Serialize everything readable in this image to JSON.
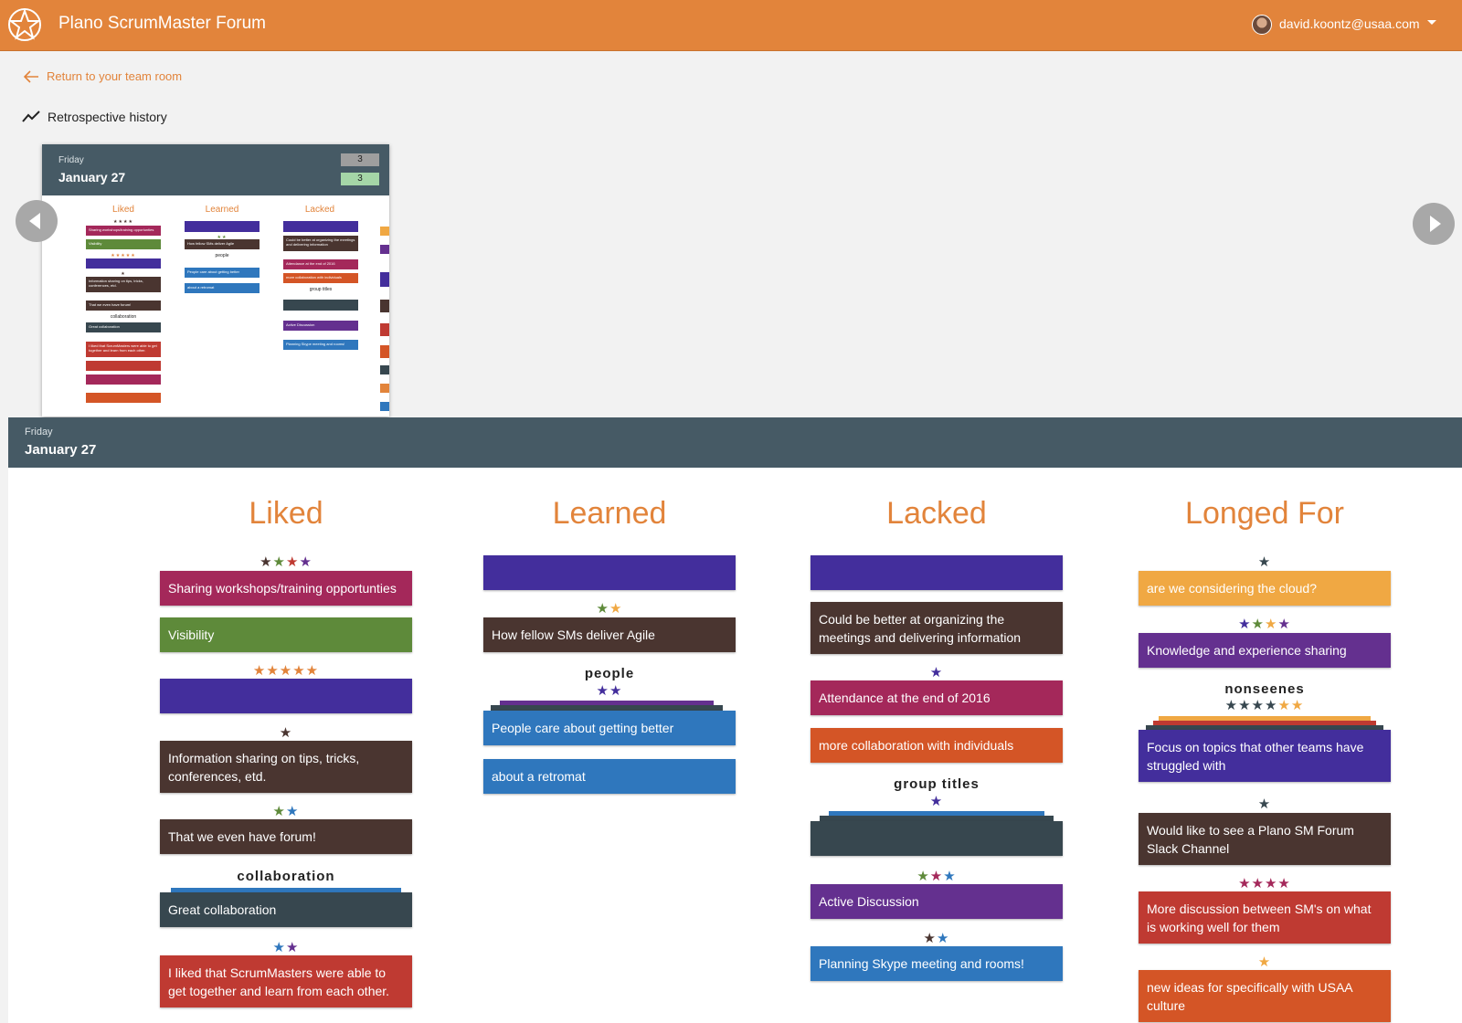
{
  "app": {
    "title": "Plano ScrumMaster Forum",
    "user_email": "david.koontz@usaa.com"
  },
  "nav": {
    "back_label": "Return to your team room",
    "history_label": "Retrospective history"
  },
  "thumbnail": {
    "day": "Friday",
    "date": "January 27",
    "badge_count_1": "3",
    "badge_count_2": "3",
    "columns": [
      "Liked",
      "Learned",
      "Lacked"
    ],
    "group_labels": [
      "people",
      "collaboration",
      "group titles"
    ]
  },
  "board": {
    "day": "Friday",
    "date": "January 27",
    "columns": {
      "liked": {
        "title": "Liked",
        "cards": [
          "Sharing workshops/training opportunties",
          "Visibility",
          "",
          "Information sharing on tips, tricks, conferences, etd.",
          "That we even have forum!",
          "Great collaboration",
          "I liked that ScrumMasters were able to get together and learn from each other."
        ],
        "group": "collaboration"
      },
      "learned": {
        "title": "Learned",
        "cards": [
          "",
          "How fellow SMs deliver Agile",
          "People care about getting better",
          "about a retromat"
        ],
        "group": "people"
      },
      "lacked": {
        "title": "Lacked",
        "cards": [
          "",
          "Could be better at organizing the meetings and delivering information",
          "Attendance at the end of 2016",
          "more collaboration with individuals",
          "",
          "Active Discussion",
          "Planning Skype meeting and rooms!"
        ],
        "group": "group titles"
      },
      "longed_for": {
        "title": "Longed For",
        "cards": [
          "are we considering the cloud?",
          "Knowledge and experience sharing",
          "Focus on topics that other teams have struggled with",
          "Would like to see a Plano SM Forum Slack Channel",
          "More discussion between SM's on what is working well for them",
          "new ideas for specifically with USAA culture"
        ],
        "group": "nonseenes"
      }
    }
  },
  "colors": {
    "accent": "#e2843b",
    "header": "#465a65",
    "magenta": "#a4285a",
    "green": "#5e8a3a",
    "indigo": "#432e9c",
    "brown": "#4a3530",
    "slate": "#37474f",
    "red": "#bf3a32",
    "orange": "#d45526",
    "blue": "#2f77bd",
    "purple": "#64308f",
    "amber": "#f0a843"
  },
  "icons": [
    "logo-icon",
    "arrow-left-icon",
    "trend-line-icon",
    "chevron-down-icon",
    "chevron-left-icon",
    "chevron-right-icon",
    "star-icon"
  ]
}
